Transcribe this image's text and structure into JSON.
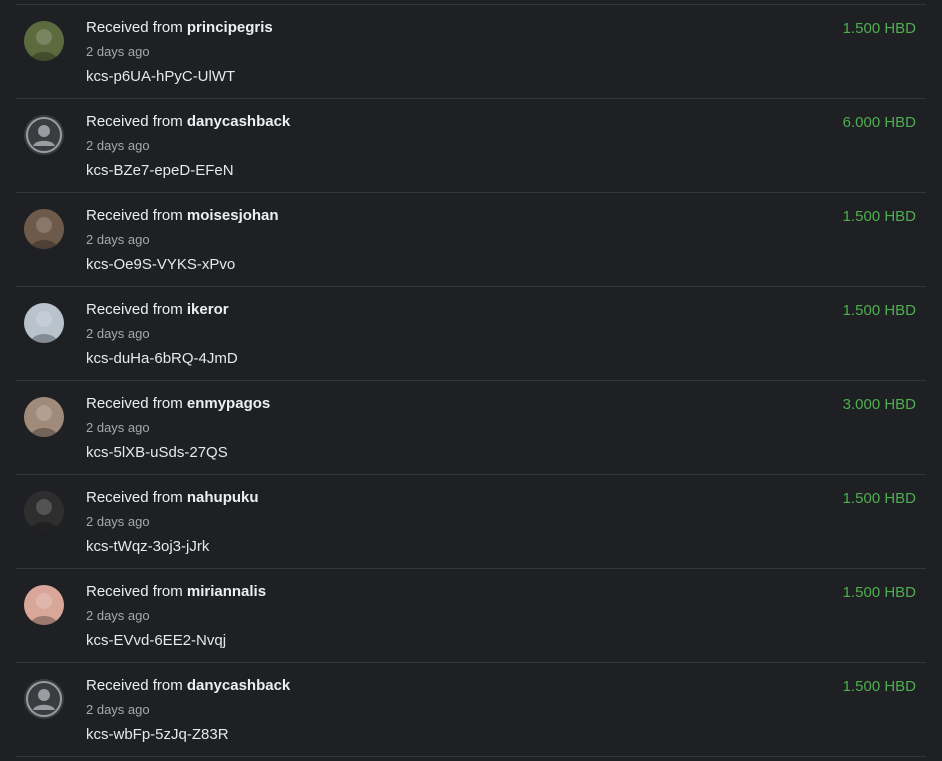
{
  "transactions": [
    {
      "prefix": "Received from",
      "user": "principegris",
      "time": "2 days ago",
      "memo": "kcs-p6UA-hPyC-UlWT",
      "amount": "1.500 HBD",
      "avatar": "photo",
      "color": "#5b6b3e"
    },
    {
      "prefix": "Received from",
      "user": "danycashback",
      "time": "2 days ago",
      "memo": "kcs-BZe7-epeD-EFeN",
      "amount": "6.000 HBD",
      "avatar": "default-user-icon",
      "color": "#3a3c40"
    },
    {
      "prefix": "Received from",
      "user": "moisesjohan",
      "time": "2 days ago",
      "memo": "kcs-Oe9S-VYKS-xPvo",
      "amount": "1.500 HBD",
      "avatar": "photo",
      "color": "#6e5a4a"
    },
    {
      "prefix": "Received from",
      "user": "ikeror",
      "time": "2 days ago",
      "memo": "kcs-duHa-6bRQ-4JmD",
      "amount": "1.500 HBD",
      "avatar": "photo",
      "color": "#b8c3cc"
    },
    {
      "prefix": "Received from",
      "user": "enmypagos",
      "time": "2 days ago",
      "memo": "kcs-5lXB-uSds-27QS",
      "amount": "3.000 HBD",
      "avatar": "photo",
      "color": "#a08a7a"
    },
    {
      "prefix": "Received from",
      "user": "nahupuku",
      "time": "2 days ago",
      "memo": "kcs-tWqz-3oj3-jJrk",
      "amount": "1.500 HBD",
      "avatar": "photo",
      "color": "#2e2e2e"
    },
    {
      "prefix": "Received from",
      "user": "miriannalis",
      "time": "2 days ago",
      "memo": "kcs-EVvd-6EE2-Nvqj",
      "amount": "1.500 HBD",
      "avatar": "photo",
      "color": "#d9a79a"
    },
    {
      "prefix": "Received from",
      "user": "danycashback",
      "time": "2 days ago",
      "memo": "kcs-wbFp-5zJq-Z83R",
      "amount": "1.500 HBD",
      "avatar": "default-user-icon",
      "color": "#3a3c40"
    }
  ],
  "colors": {
    "background": "#1f2023",
    "amount": "#4caf50",
    "divider": "#34363a"
  }
}
